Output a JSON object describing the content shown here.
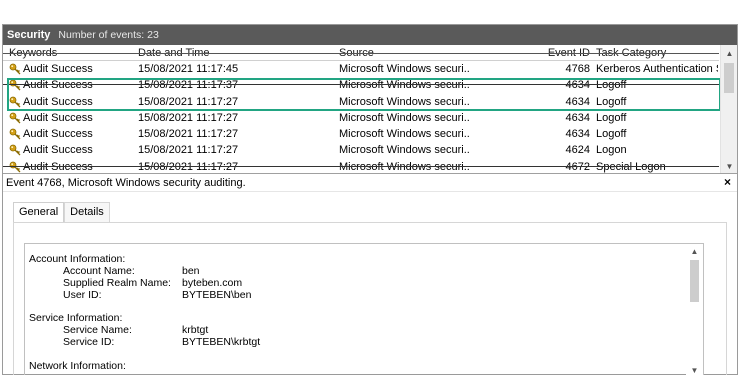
{
  "header": {
    "title": "Security",
    "events_label": "Number of events: 23"
  },
  "columns": {
    "keywords": "Keywords",
    "datetime": "Date and Time",
    "source": "Source",
    "event_id": "Event ID",
    "task_category": "Task Category"
  },
  "rows": [
    {
      "keywords": "Audit Success",
      "datetime": "15/08/2021 11:17:45",
      "source": "Microsoft Windows securi...",
      "event_id": "4768",
      "task_category": "Kerberos Authentication S..."
    },
    {
      "keywords": "Audit Success",
      "datetime": "15/08/2021 11:17:37",
      "source": "Microsoft Windows securi...",
      "event_id": "4634",
      "task_category": "Logoff"
    },
    {
      "keywords": "Audit Success",
      "datetime": "15/08/2021 11:17:27",
      "source": "Microsoft Windows securi...",
      "event_id": "4634",
      "task_category": "Logoff"
    },
    {
      "keywords": "Audit Success",
      "datetime": "15/08/2021 11:17:27",
      "source": "Microsoft Windows securi...",
      "event_id": "4634",
      "task_category": "Logoff"
    },
    {
      "keywords": "Audit Success",
      "datetime": "15/08/2021 11:17:27",
      "source": "Microsoft Windows securi...",
      "event_id": "4634",
      "task_category": "Logoff"
    },
    {
      "keywords": "Audit Success",
      "datetime": "15/08/2021 11:17:27",
      "source": "Microsoft Windows securi...",
      "event_id": "4624",
      "task_category": "Logon"
    },
    {
      "keywords": "Audit Success",
      "datetime": "15/08/2021 11:17:27",
      "source": "Microsoft Windows securi...",
      "event_id": "4672",
      "task_category": "Special Logon"
    }
  ],
  "detail": {
    "title": "Event 4768, Microsoft Windows security auditing.",
    "close_glyph": "×",
    "tabs": [
      "General",
      "Details"
    ],
    "lines": {
      "account_info": "Account Information:",
      "account_name_label": "Account Name:",
      "account_name_value": "ben",
      "realm_label": "Supplied Realm Name:",
      "realm_value": "byteben.com",
      "user_id_label": "User ID:",
      "user_id_value": "BYTEBEN\\ben",
      "service_info": "Service Information:",
      "service_name_label": "Service Name:",
      "service_name_value": "krbtgt",
      "service_id_label": "Service ID:",
      "service_id_value": "BYTEBEN\\krbtgt",
      "network_info": "Network Information:"
    }
  },
  "icons": {
    "row_icon": "key-icon",
    "close": "close-icon",
    "scroll_up": "chevron-up-icon",
    "scroll_down": "chevron-down-icon"
  },
  "colors": {
    "header_bg": "#5a5a5a",
    "highlight": "#22a583",
    "key_icon": "#d4a017"
  }
}
